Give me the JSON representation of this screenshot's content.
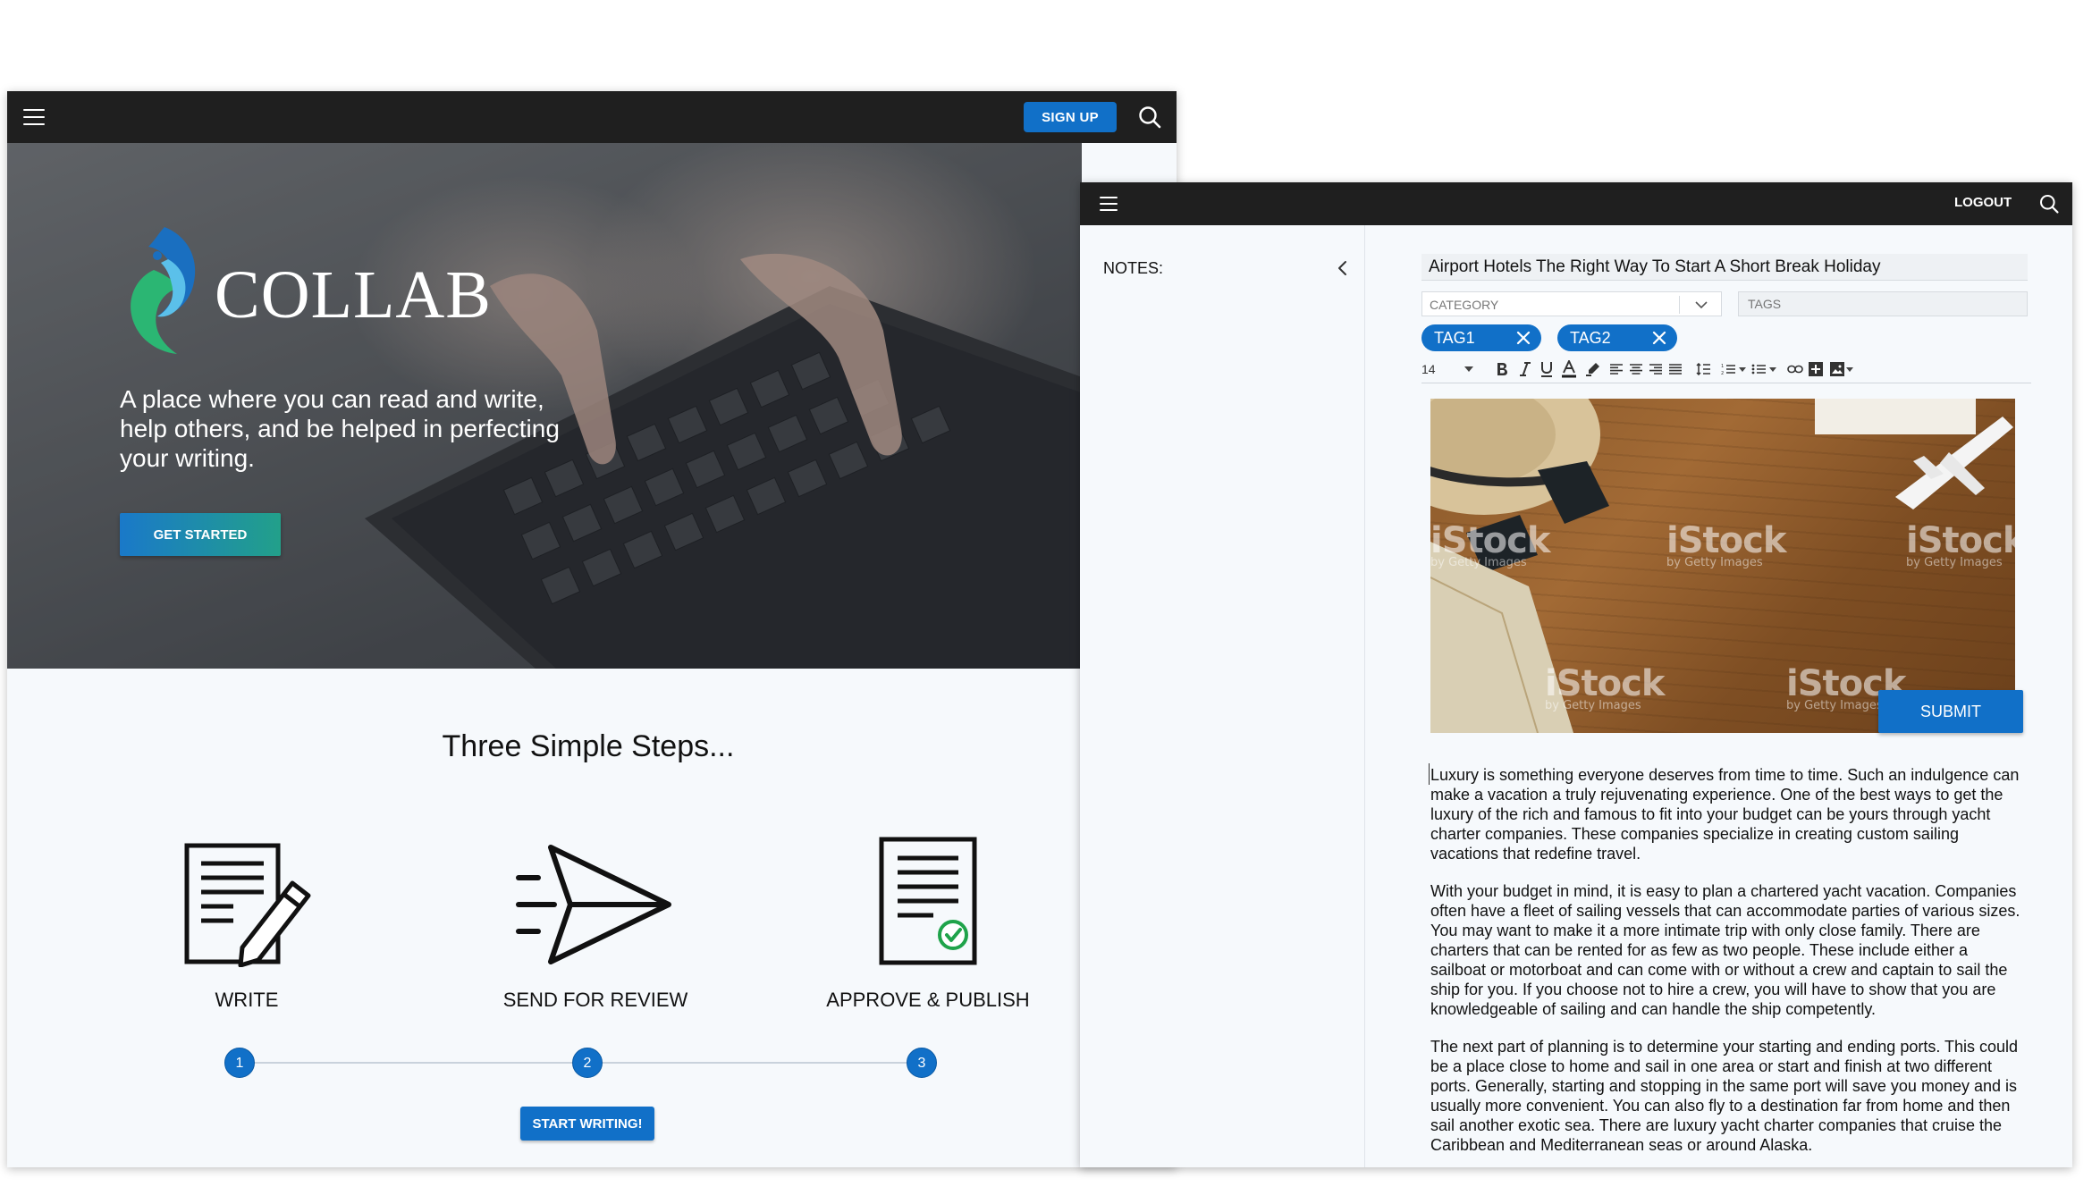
{
  "landing": {
    "signup_label": "SIGN UP",
    "logo_text": "COLLAB",
    "tagline": "A place where you can read and write, help others, and be helped in perfecting your writing.",
    "get_started_label": "GET STARTED",
    "steps_title": "Three Simple Steps...",
    "steps": [
      {
        "label": "WRITE",
        "number": "1"
      },
      {
        "label": "SEND FOR REVIEW",
        "number": "2"
      },
      {
        "label": "APPROVE & PUBLISH",
        "number": "3"
      }
    ],
    "start_writing_label": "START WRITING!"
  },
  "editor": {
    "logout_label": "LOGOUT",
    "notes_label": "NOTES:",
    "title_value": "Airport Hotels The Right Way To Start A Short Break Holiday",
    "category_placeholder": "CATEGORY",
    "tags_placeholder": "TAGS",
    "tags": [
      "TAG1",
      "TAG2"
    ],
    "font_size": "14",
    "watermark_text": "iStock",
    "watermark_sub": "by Getty Images",
    "submit_label": "SUBMIT",
    "paragraphs": [
      "Luxury is something everyone deserves from time to time. Such an indulgence can make a vacation a truly rejuvenating experience. One of the best ways to get the luxury of the rich and famous to fit into your budget can be yours through yacht charter companies. These companies specialize in creating custom sailing vacations that redefine travel.",
      "With your budget in mind, it is easy to plan a chartered yacht vacation. Companies often have a fleet of sailing vessels that can accommodate parties of various sizes. You may want to make it a more intimate trip with only close family. There are charters that can be rented for as few as two people. These include either a sailboat or motorboat and can come with or without a crew and captain to sail the ship for you. If you choose not to hire a crew, you will have to show that you are knowledgeable of sailing and can handle the ship competently.",
      "The next part of planning is to determine your starting and ending ports. This could be a place close to home and sail in one area or start and finish at two different ports. Generally, starting and stopping in the same port will save you money and is usually more convenient. You can also fly to a destination far from home and then sail another exotic sea. There are luxury yacht charter companies that cruise the Caribbean and Mediterranean seas or around Alaska."
    ]
  },
  "colors": {
    "accent_blue": "#1170c8",
    "navbar": "#1f1f1f",
    "page_bg": "#f6f9fc",
    "check_green": "#1fa34a",
    "logo_blue": "#1a6fc0",
    "logo_green": "#2bb673"
  },
  "icons": [
    "menu-icon",
    "search-icon",
    "chevron-left-icon",
    "chevron-down-icon",
    "close-icon",
    "document-pen-icon",
    "paper-plane-icon",
    "document-check-icon"
  ]
}
